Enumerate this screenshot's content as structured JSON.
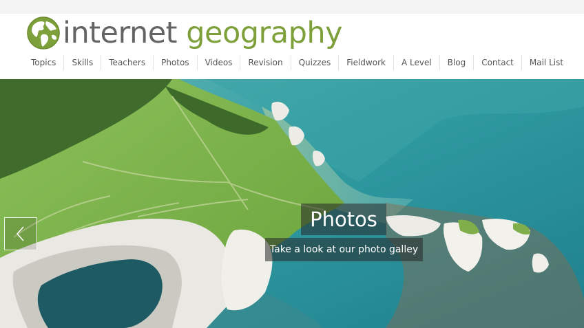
{
  "logo": {
    "icon": "globe-icon",
    "word1": "internet",
    "word2": "geography"
  },
  "nav": {
    "items": [
      {
        "label": "Topics"
      },
      {
        "label": "Skills"
      },
      {
        "label": "Teachers"
      },
      {
        "label": "Photos"
      },
      {
        "label": "Videos"
      },
      {
        "label": "Revision"
      },
      {
        "label": "Quizzes"
      },
      {
        "label": "Fieldwork"
      },
      {
        "label": "A Level"
      },
      {
        "label": "Blog"
      },
      {
        "label": "Contact"
      },
      {
        "label": "Mail List"
      }
    ]
  },
  "slider": {
    "prev_icon": "chevron-left-icon",
    "caption_title": "Photos",
    "caption_subtitle": "Take a look at our photo galley"
  },
  "colors": {
    "logo_grey": "#646464",
    "logo_green": "#7ea03a",
    "nav_text": "#555555",
    "sea": "#2f9aa0",
    "grass": "#7fb247"
  }
}
